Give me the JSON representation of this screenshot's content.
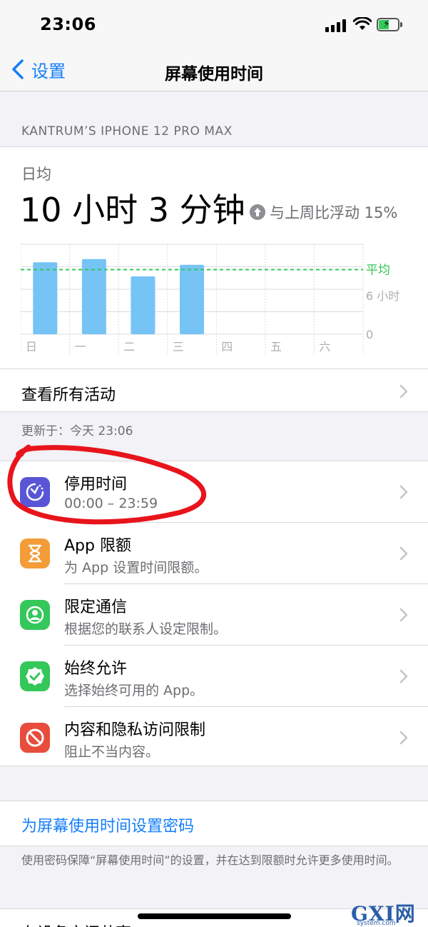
{
  "status_bar": {
    "time": "23:06"
  },
  "nav": {
    "back_label": "设置",
    "title": "屏幕使用时间"
  },
  "device_name": "KANTRUM’S IPHONE 12 PRO MAX",
  "summary": {
    "daily_label": "日均",
    "daily_value": "10 小时 3 分钟",
    "trend_text": "与上周比浮动 15%",
    "view_all_label": "查看所有活动"
  },
  "chart_data": {
    "type": "bar",
    "categories": [
      "日",
      "一",
      "二",
      "三",
      "四",
      "五",
      "六"
    ],
    "values": [
      11.2,
      11.7,
      9.0,
      10.8,
      null,
      null,
      null
    ],
    "average": 10.05,
    "average_label": "平均",
    "y_tick_labels": [
      "6 小时",
      "0"
    ],
    "ylim": [
      0,
      14
    ],
    "grid": true,
    "colors": {
      "bar": "#76c3f5",
      "average_line": "#34c759",
      "grid": "#dcdce0"
    }
  },
  "updated_text": "更新于：今天 23:06",
  "list": [
    {
      "title": "停用时间",
      "subtitle": "00:00 – 23:59",
      "icon": "downtime-icon",
      "color": "#5856d6"
    },
    {
      "title": "App 限额",
      "subtitle": "为 App 设置时间限额。",
      "icon": "hourglass-icon",
      "color": "#f39c38"
    },
    {
      "title": "限定通信",
      "subtitle": "根据您的联系人设定限制。",
      "icon": "contact-icon",
      "color": "#34c759"
    },
    {
      "title": "始终允许",
      "subtitle": "选择始终可用的 App。",
      "icon": "checkmark-badge-icon",
      "color": "#34c759"
    },
    {
      "title": "内容和隐私访问限制",
      "subtitle": "阻止不当内容。",
      "icon": "restriction-icon",
      "color": "#e74c3c"
    }
  ],
  "passcode": {
    "link_label": "为屏幕使用时间设置密码",
    "footer": "使用密码保障“屏幕使用时间”的设置，并在达到限额时允许更多使用时间。"
  },
  "next_row_label": "在设备之间共享",
  "watermark": {
    "brand": "GXI网",
    "sub": "system.com"
  },
  "colors": {
    "accent": "#147efb",
    "annotation": "#e8141c"
  }
}
